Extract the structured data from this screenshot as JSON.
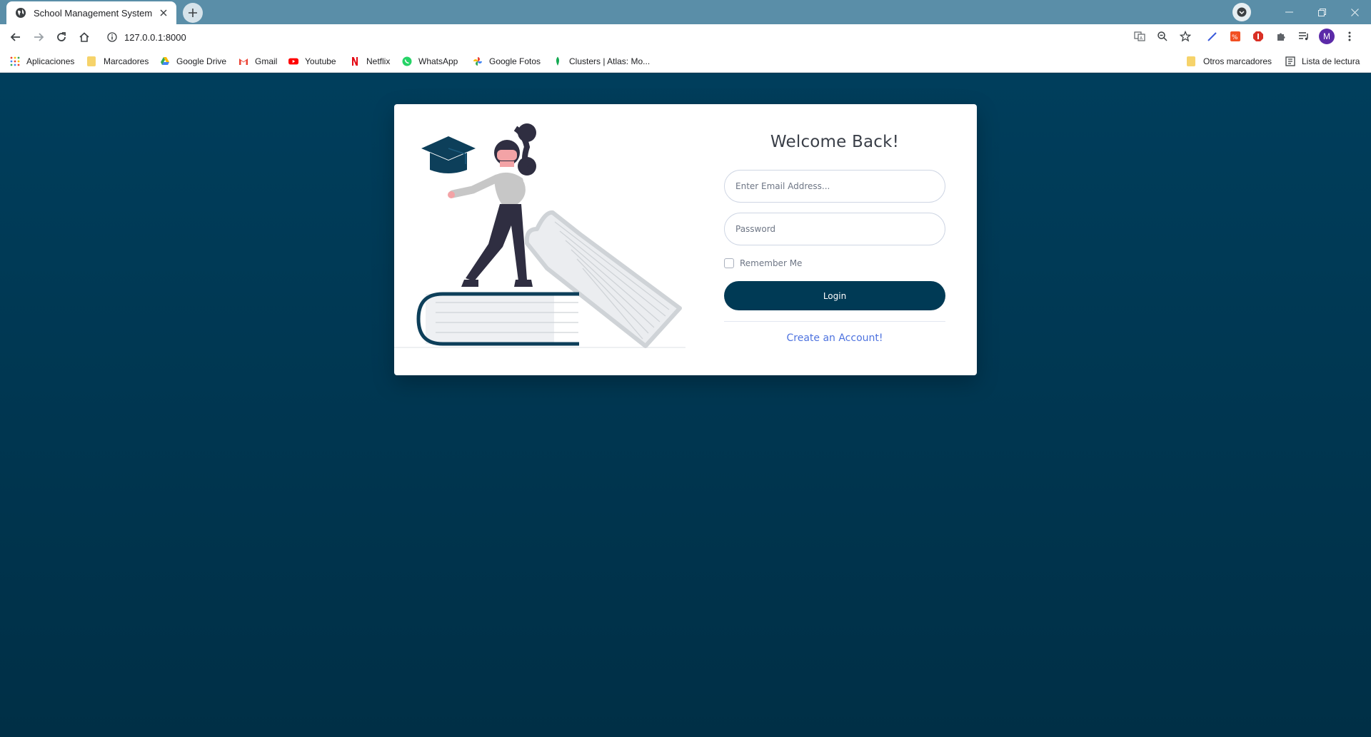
{
  "browser": {
    "tab_title": "School Management System",
    "url": "127.0.0.1:8000",
    "profile_initial": "M",
    "bookmarks": [
      {
        "label": "Aplicaciones",
        "icon": "apps-grid-icon"
      },
      {
        "label": "Marcadores",
        "icon": "folder-icon"
      },
      {
        "label": "Google Drive",
        "icon": "google-drive-icon"
      },
      {
        "label": "Gmail",
        "icon": "gmail-icon"
      },
      {
        "label": "Youtube",
        "icon": "youtube-icon"
      },
      {
        "label": "Netflix",
        "icon": "netflix-icon"
      },
      {
        "label": "WhatsApp",
        "icon": "whatsapp-icon"
      },
      {
        "label": "Google Fotos",
        "icon": "google-photos-icon"
      },
      {
        "label": "Clusters | Atlas: Mo...",
        "icon": "mongodb-leaf-icon"
      }
    ],
    "other_bookmarks": "Otros marcadores",
    "reading_list": "Lista de lectura"
  },
  "login": {
    "title": "Welcome Back!",
    "email_placeholder": "Enter Email Address...",
    "password_placeholder": "Password",
    "remember_label": "Remember Me",
    "login_button": "Login",
    "create_account": "Create an Account!"
  },
  "colors": {
    "page_background": "#003a55",
    "button": "#003a55",
    "link": "#4e73df"
  }
}
